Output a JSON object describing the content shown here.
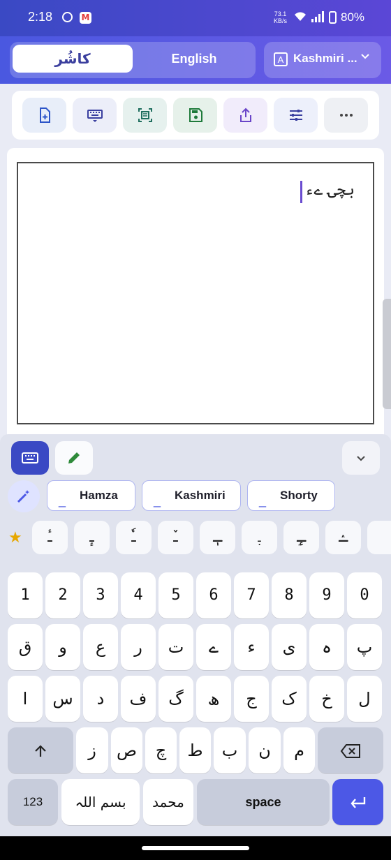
{
  "status_bar": {
    "time": "2:18",
    "net_speed_value": "73.1",
    "net_speed_unit": "KB/s",
    "battery": "80%"
  },
  "header": {
    "toggle_options": [
      "کاشُر",
      "English"
    ],
    "active_option": "کاشُر",
    "language_select": "Kashmiri ..."
  },
  "toolbar": {
    "buttons": [
      {
        "name": "new-file",
        "icon": "file-plus-icon",
        "bg": "#e8eef9"
      },
      {
        "name": "keyboard",
        "icon": "keyboard-icon",
        "bg": "#eceef9"
      },
      {
        "name": "scan",
        "icon": "scan-document-icon",
        "bg": "#e6f1ee"
      },
      {
        "name": "save",
        "icon": "save-icon",
        "bg": "#e6f1ea"
      },
      {
        "name": "share",
        "icon": "share-icon",
        "bg": "#f1ecfb"
      },
      {
        "name": "settings",
        "icon": "tune-icon",
        "bg": "#edf0fb"
      },
      {
        "name": "more",
        "icon": "more-horizontal-icon",
        "bg": "#eef0f4"
      }
    ]
  },
  "editor": {
    "text": "بچۍ ےء"
  },
  "keyboard": {
    "accent": "#4c58e6",
    "suggestion_chips": [
      "Hamza",
      "Kashmiri",
      "Shorty"
    ],
    "chip_prefix": "_",
    "diacritics": [
      "ـٔ",
      "ـٕ",
      "ـٗ",
      "ـٚ",
      "ـٖ",
      "ـٜ",
      "ـٟ",
      "ـٛ"
    ],
    "row_numbers": [
      "1",
      "2",
      "3",
      "4",
      "5",
      "6",
      "7",
      "8",
      "9",
      "0"
    ],
    "row1": [
      "ق",
      "و",
      "ع",
      "ر",
      "ت",
      "ے",
      "ء",
      "ی",
      "ہ",
      "پ"
    ],
    "row2": [
      "ا",
      "س",
      "د",
      "ف",
      "گ",
      "ھ",
      "ج",
      "ک",
      "خ",
      "ل"
    ],
    "row3": [
      "ز",
      "ص",
      "چ",
      "ط",
      "ب",
      "ن",
      "م"
    ],
    "bottom": {
      "k123": "123",
      "bismillah": "بسم اللہ",
      "muhammad": "محمد",
      "space": "space"
    }
  }
}
